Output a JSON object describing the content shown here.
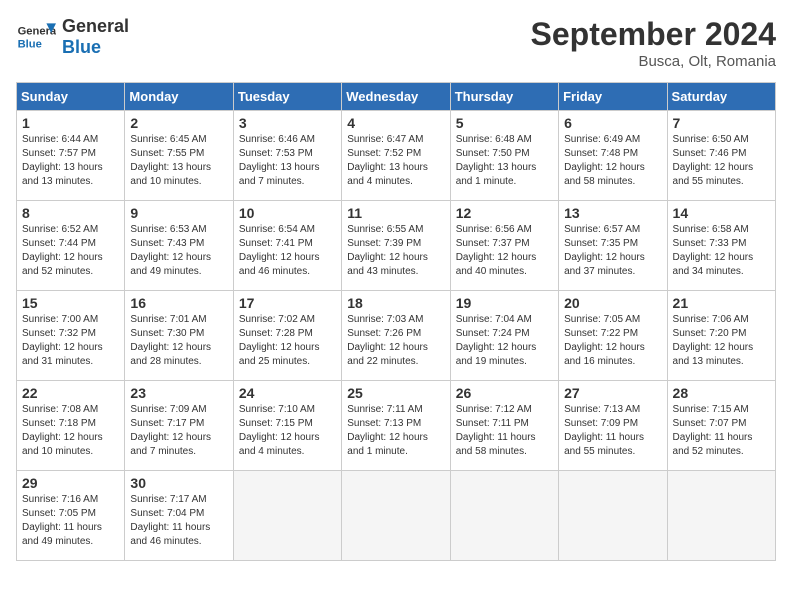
{
  "logo": {
    "general": "General",
    "blue": "Blue"
  },
  "header": {
    "month": "September 2024",
    "location": "Busca, Olt, Romania"
  },
  "weekdays": [
    "Sunday",
    "Monday",
    "Tuesday",
    "Wednesday",
    "Thursday",
    "Friday",
    "Saturday"
  ],
  "days": [
    {
      "num": "",
      "info": ""
    },
    {
      "num": "",
      "info": ""
    },
    {
      "num": "",
      "info": ""
    },
    {
      "num": "",
      "info": ""
    },
    {
      "num": "",
      "info": ""
    },
    {
      "num": "",
      "info": ""
    },
    {
      "num": "1",
      "sunrise": "6:44 AM",
      "sunset": "7:57 PM",
      "daylight": "13 hours and 13 minutes."
    },
    {
      "num": "2",
      "sunrise": "6:45 AM",
      "sunset": "7:55 PM",
      "daylight": "13 hours and 10 minutes."
    },
    {
      "num": "3",
      "sunrise": "6:46 AM",
      "sunset": "7:53 PM",
      "daylight": "13 hours and 7 minutes."
    },
    {
      "num": "4",
      "sunrise": "6:47 AM",
      "sunset": "7:52 PM",
      "daylight": "13 hours and 4 minutes."
    },
    {
      "num": "5",
      "sunrise": "6:48 AM",
      "sunset": "7:50 PM",
      "daylight": "13 hours and 1 minute."
    },
    {
      "num": "6",
      "sunrise": "6:49 AM",
      "sunset": "7:48 PM",
      "daylight": "12 hours and 58 minutes."
    },
    {
      "num": "7",
      "sunrise": "6:50 AM",
      "sunset": "7:46 PM",
      "daylight": "12 hours and 55 minutes."
    },
    {
      "num": "8",
      "sunrise": "6:52 AM",
      "sunset": "7:44 PM",
      "daylight": "12 hours and 52 minutes."
    },
    {
      "num": "9",
      "sunrise": "6:53 AM",
      "sunset": "7:43 PM",
      "daylight": "12 hours and 49 minutes."
    },
    {
      "num": "10",
      "sunrise": "6:54 AM",
      "sunset": "7:41 PM",
      "daylight": "12 hours and 46 minutes."
    },
    {
      "num": "11",
      "sunrise": "6:55 AM",
      "sunset": "7:39 PM",
      "daylight": "12 hours and 43 minutes."
    },
    {
      "num": "12",
      "sunrise": "6:56 AM",
      "sunset": "7:37 PM",
      "daylight": "12 hours and 40 minutes."
    },
    {
      "num": "13",
      "sunrise": "6:57 AM",
      "sunset": "7:35 PM",
      "daylight": "12 hours and 37 minutes."
    },
    {
      "num": "14",
      "sunrise": "6:58 AM",
      "sunset": "7:33 PM",
      "daylight": "12 hours and 34 minutes."
    },
    {
      "num": "15",
      "sunrise": "7:00 AM",
      "sunset": "7:32 PM",
      "daylight": "12 hours and 31 minutes."
    },
    {
      "num": "16",
      "sunrise": "7:01 AM",
      "sunset": "7:30 PM",
      "daylight": "12 hours and 28 minutes."
    },
    {
      "num": "17",
      "sunrise": "7:02 AM",
      "sunset": "7:28 PM",
      "daylight": "12 hours and 25 minutes."
    },
    {
      "num": "18",
      "sunrise": "7:03 AM",
      "sunset": "7:26 PM",
      "daylight": "12 hours and 22 minutes."
    },
    {
      "num": "19",
      "sunrise": "7:04 AM",
      "sunset": "7:24 PM",
      "daylight": "12 hours and 19 minutes."
    },
    {
      "num": "20",
      "sunrise": "7:05 AM",
      "sunset": "7:22 PM",
      "daylight": "12 hours and 16 minutes."
    },
    {
      "num": "21",
      "sunrise": "7:06 AM",
      "sunset": "7:20 PM",
      "daylight": "12 hours and 13 minutes."
    },
    {
      "num": "22",
      "sunrise": "7:08 AM",
      "sunset": "7:18 PM",
      "daylight": "12 hours and 10 minutes."
    },
    {
      "num": "23",
      "sunrise": "7:09 AM",
      "sunset": "7:17 PM",
      "daylight": "12 hours and 7 minutes."
    },
    {
      "num": "24",
      "sunrise": "7:10 AM",
      "sunset": "7:15 PM",
      "daylight": "12 hours and 4 minutes."
    },
    {
      "num": "25",
      "sunrise": "7:11 AM",
      "sunset": "7:13 PM",
      "daylight": "12 hours and 1 minute."
    },
    {
      "num": "26",
      "sunrise": "7:12 AM",
      "sunset": "7:11 PM",
      "daylight": "11 hours and 58 minutes."
    },
    {
      "num": "27",
      "sunrise": "7:13 AM",
      "sunset": "7:09 PM",
      "daylight": "11 hours and 55 minutes."
    },
    {
      "num": "28",
      "sunrise": "7:15 AM",
      "sunset": "7:07 PM",
      "daylight": "11 hours and 52 minutes."
    },
    {
      "num": "29",
      "sunrise": "7:16 AM",
      "sunset": "7:05 PM",
      "daylight": "11 hours and 49 minutes."
    },
    {
      "num": "30",
      "sunrise": "7:17 AM",
      "sunset": "7:04 PM",
      "daylight": "11 hours and 46 minutes."
    }
  ]
}
